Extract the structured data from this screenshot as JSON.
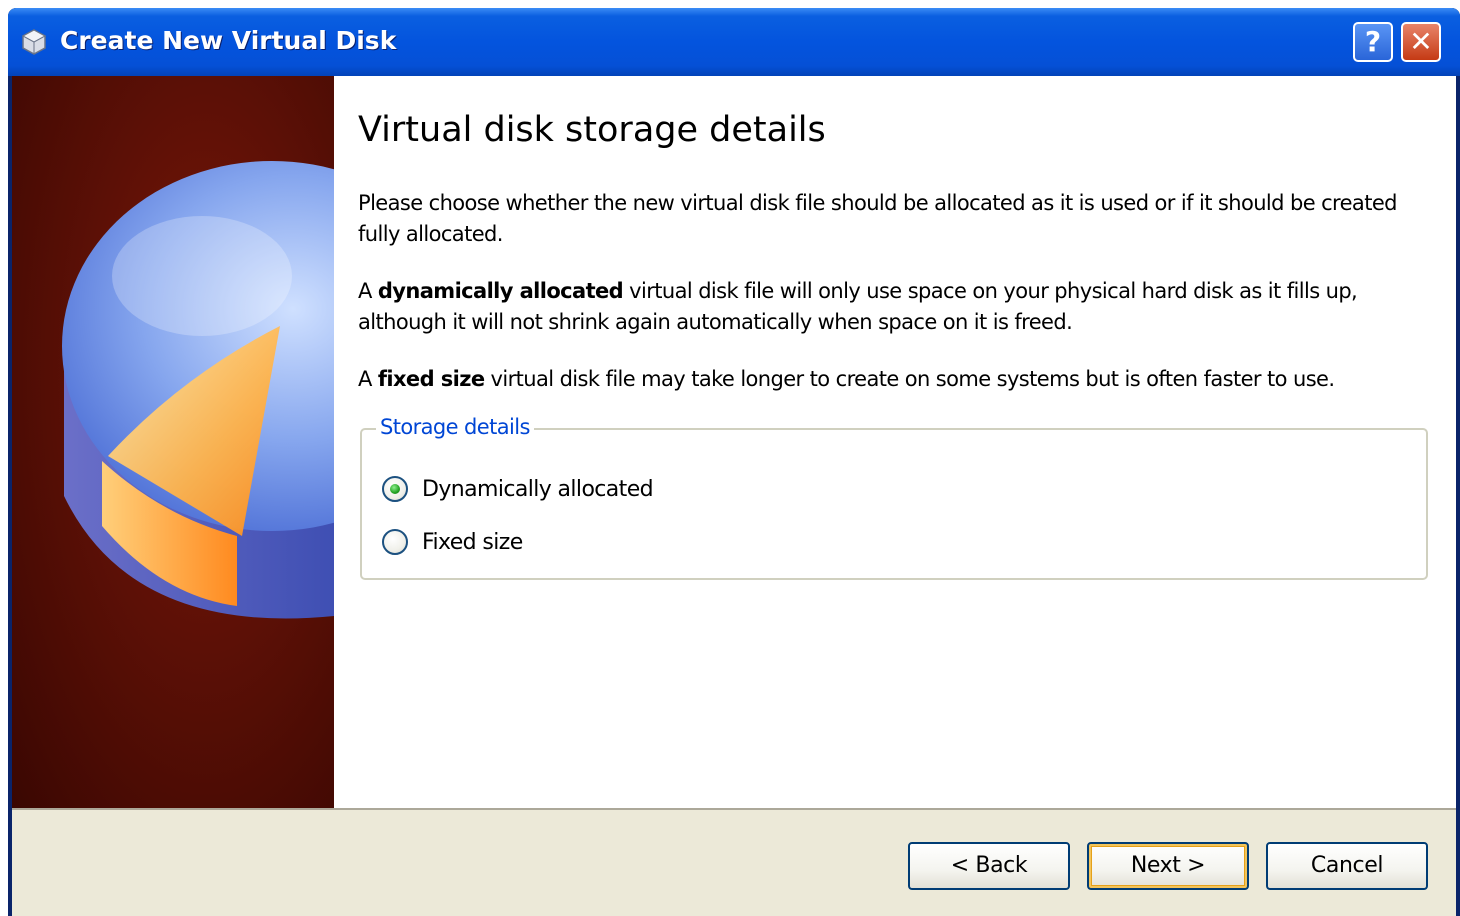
{
  "window": {
    "title": "Create New Virtual Disk",
    "help_label": "?",
    "close_label": "✕"
  },
  "page": {
    "title": "Virtual disk storage details",
    "intro": "Please choose whether the new virtual disk file should be allocated as it is used or if it should be created fully allocated.",
    "dynamic_desc": {
      "prefix": "A ",
      "bold": "dynamically allocated",
      "suffix": " virtual disk file will only use space on your physical hard disk as it fills up, although it will not shrink again automatically when space on it is freed."
    },
    "fixed_desc": {
      "prefix": "A ",
      "bold": "fixed size",
      "suffix": " virtual disk file may take longer to create on some systems but is often faster to use."
    }
  },
  "storage_details": {
    "legend": "Storage details",
    "options": [
      {
        "label": "Dynamically allocated",
        "selected": true
      },
      {
        "label": "Fixed size",
        "selected": false
      }
    ]
  },
  "buttons": {
    "back": "< Back",
    "next": "Next >",
    "cancel": "Cancel"
  },
  "colors": {
    "titlebar": "#0454de",
    "legend": "#0046d5",
    "footer": "#ece9d8",
    "banner": "#5c1006",
    "radio_selected": "#21a121"
  }
}
